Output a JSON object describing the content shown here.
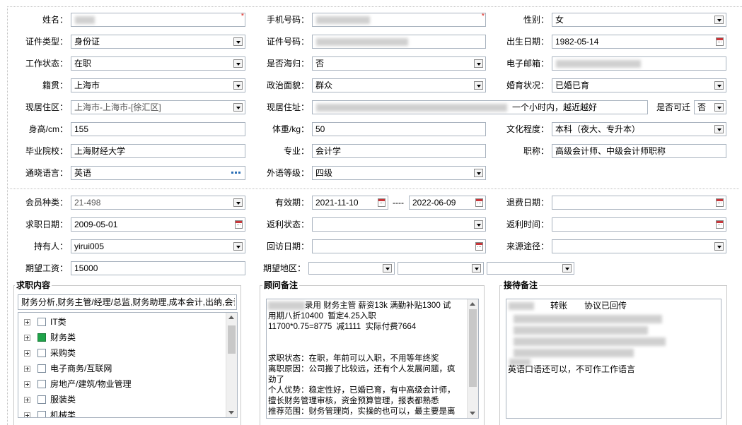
{
  "labels": {
    "name": "姓名：",
    "phone": "手机号码：",
    "gender": "性别：",
    "id_type": "证件类型：",
    "id_no": "证件号码：",
    "birth": "出生日期：",
    "work_status": "工作状态：",
    "overseas": "是否海归：",
    "email": "电子邮箱：",
    "native": "籍贯：",
    "political": "政治面貌：",
    "marital": "婚育状况：",
    "residence_area": "现居住区：",
    "residence_addr": "现居住址：",
    "accept_commute": "是否可迁",
    "height": "身高/cm：",
    "weight": "体重/kg：",
    "education": "文化程度：",
    "school": "毕业院校：",
    "major": "专业：",
    "title": "职称：",
    "language": "通晓语言：",
    "foreign_level": "外语等级：",
    "member_type": "会员种类：",
    "valid_period": "有效期：",
    "period_sep": "----",
    "refund_date": "退费日期：",
    "job_date": "求职日期：",
    "rebate_status": "返利状态：",
    "rebate_time": "返利时间：",
    "holder": "持有人：",
    "visit_date": "回访日期：",
    "source": "来源途径：",
    "expected_salary": "期望工资：",
    "expected_area": "期望地区："
  },
  "values": {
    "gender": "女",
    "id_type": "身份证",
    "birth": "1982-05-14",
    "work_status": "在职",
    "overseas": "否",
    "native": "上海市",
    "political": "群众",
    "marital": "已婚已育",
    "residence_area": "上海市-上海市-[徐汇区]",
    "residence_addr_visible": "一个小时内，越近越好",
    "accept_commute": "否",
    "height": "155",
    "weight": "50",
    "education": "本科（夜大、专升本）",
    "school": "上海财经大学",
    "major": "会计学",
    "title": "高级会计师、中级会计师职称",
    "language": "英语",
    "foreign_level": "四级",
    "member_type": "21-498",
    "valid_from": "2021-11-10",
    "valid_to": "2022-06-09",
    "refund_date": "",
    "job_date": "2009-05-01",
    "rebate_status": "",
    "rebate_time": "",
    "holder": "yirui005",
    "visit_date": "",
    "source": "",
    "expected_salary": "15000",
    "expected_area_1": "",
    "expected_area_2": "",
    "expected_area_3": ""
  },
  "job_content": {
    "title": "求职内容",
    "summary": "财务分析,财务主管/经理/总监,财务助理,成本会计,出纳,会计",
    "tree": [
      {
        "label": "IT类",
        "checked": false
      },
      {
        "label": "财务类",
        "checked": true
      },
      {
        "label": "采购类",
        "checked": false
      },
      {
        "label": "电子商务/互联网",
        "checked": false
      },
      {
        "label": "房地产/建筑/物业管理",
        "checked": false
      },
      {
        "label": "服装类",
        "checked": false
      },
      {
        "label": "机械类",
        "checked": false
      }
    ]
  },
  "advisor_notes": {
    "title": "顾问备注",
    "text": "录用 财务主管 薪资13k 满勤补贴1300 试\n用期八折10400  暂定4.25入职\n11700*0.75=8775  减1111  实际付费7664\n\n\n求职状态：在职，年前可以入职，不用等年终奖\n离职原因：公司搬了比较远，还有个人发展问题，疯\n劲了\n个人优势：稳定性好，已婚已育，有中高级会计师，\n擅长财务管理审核，资金预算管理，报表都熟悉\n推荐范围：财务管理岗，实操的也可以，最主要是离"
  },
  "reception_notes": {
    "title": "接待备注",
    "line1_a": "转账",
    "line1_b": "协议已回传",
    "line_last": "英语口语还可以，不可作工作语言"
  },
  "colors": {
    "required": "#e0312a",
    "checked": "#1fa34a",
    "icon_blue": "#2a6fb6",
    "border": "#a9b3bf"
  }
}
